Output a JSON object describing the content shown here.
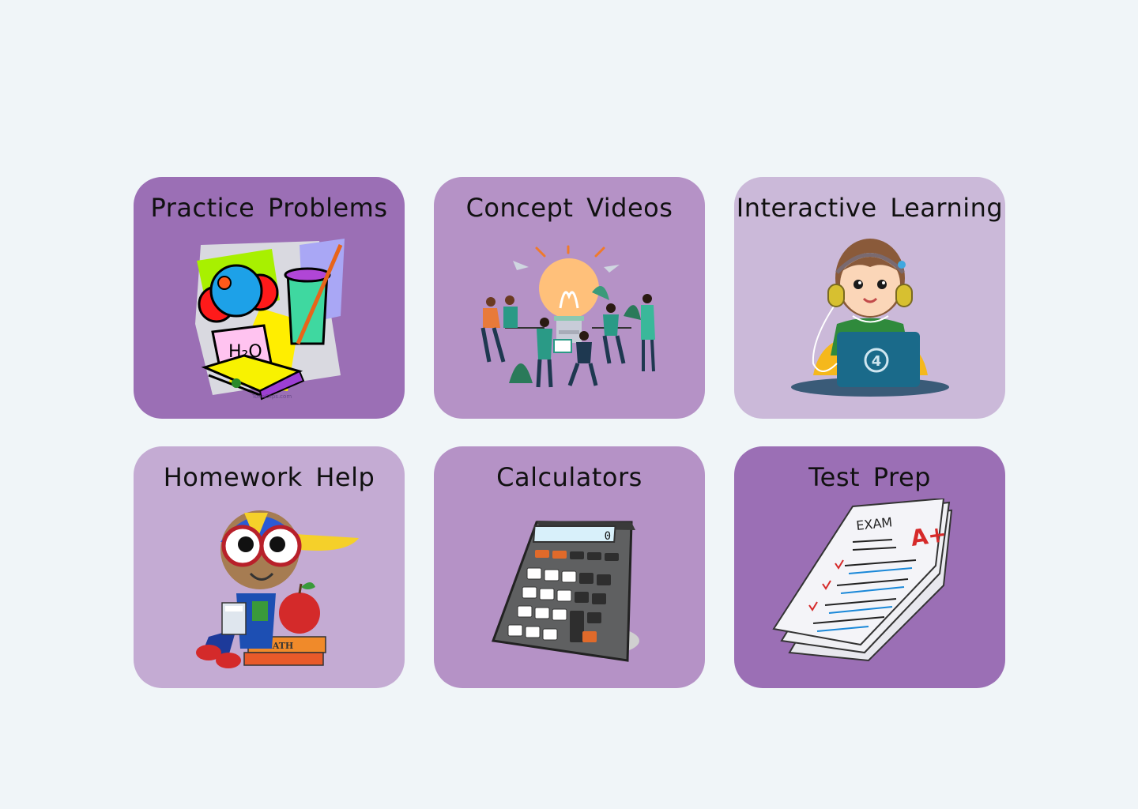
{
  "cards": [
    {
      "title": "Practice Problems",
      "color": "#9b6fb5",
      "icon": "chemistry-clipart-icon",
      "art_text": "H₂O",
      "credit": "ToonClips.com"
    },
    {
      "title": "Concept Videos",
      "color": "#b592c6",
      "icon": "lightbulb-team-icon"
    },
    {
      "title": "Interactive Learning",
      "color": "#cbb9d9",
      "icon": "girl-laptop-icon",
      "art_text": "4"
    },
    {
      "title": "Homework Help",
      "color": "#c4abd3",
      "icon": "student-math-icon",
      "art_text": "MATH"
    },
    {
      "title": "Calculators",
      "color": "#b592c6",
      "icon": "calculator-icon",
      "art_text": "0"
    },
    {
      "title": "Test Prep",
      "color": "#9b6fb5",
      "icon": "exam-paper-icon",
      "art_text": "EXAM",
      "art_grade": "A+"
    }
  ]
}
